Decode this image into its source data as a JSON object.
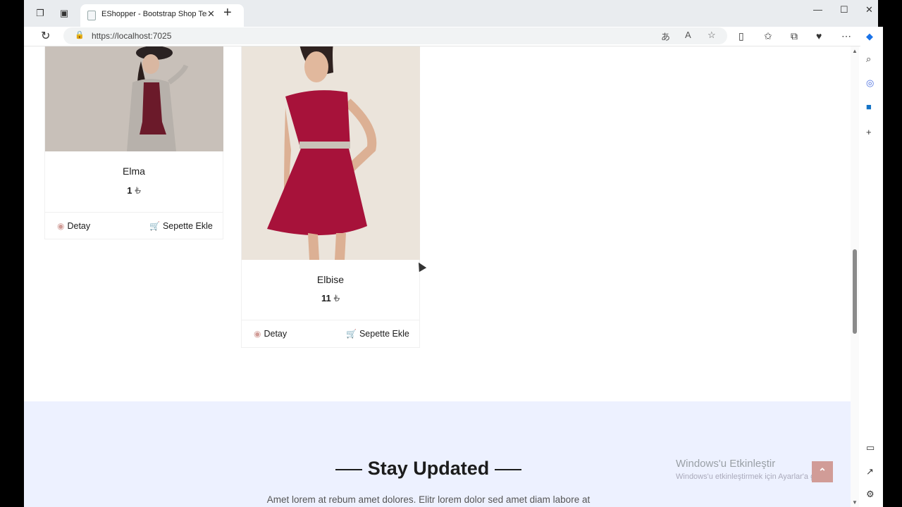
{
  "browser": {
    "tab_title": "EShopper - Bootstrap Shop Temp",
    "url": "https://localhost:7025"
  },
  "products": [
    {
      "name": "Elma",
      "price": "1",
      "currency": "₺",
      "detail_label": "Detay",
      "cart_label": "Sepette Ekle"
    },
    {
      "name": "Elbise",
      "price": "11",
      "currency": "₺",
      "detail_label": "Detay",
      "cart_label": "Sepette Ekle"
    }
  ],
  "newsletter": {
    "title": "Stay Updated",
    "text": "Amet lorem at rebum amet dolores. Elitr lorem dolor sed amet diam labore at"
  },
  "watermark": {
    "title": "Windows'u Etkinleştir",
    "subtitle": "Windows'u etkinleştirmek için Ayarlar'a gidin."
  },
  "icons": [
    "eye-icon",
    "cart-icon",
    "lock-icon",
    "reload-icon",
    "chevron-up-icon"
  ],
  "colors": {
    "accent": "#d19c97",
    "newsletter_bg": "#edf1ff"
  }
}
